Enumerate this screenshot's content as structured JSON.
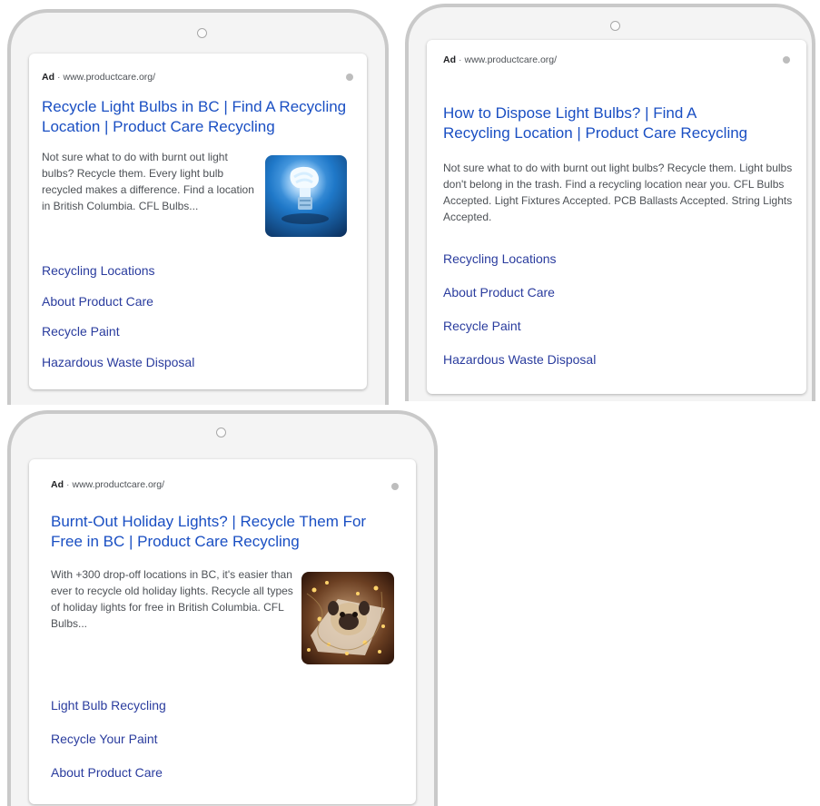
{
  "ads": [
    {
      "label": "Ad",
      "url": "www.productcare.org/",
      "headline_line1": "Recycle Light Bulbs in BC | Find A Recycling",
      "headline_line2": "Location | Product Care Recycling",
      "description": "Not sure what to do with burnt out light bulbs? Recycle them. Every light bulb recycled makes a difference. Find a location in British Columbia. CFL Bulbs...",
      "image_icon": "light-bulb-image",
      "sitelinks": [
        "Recycling Locations",
        "About Product Care",
        "Recycle Paint",
        "Hazardous Waste Disposal"
      ]
    },
    {
      "label": "Ad",
      "url": "www.productcare.org/",
      "headline_line1": "How to Dispose Light Bulbs? | Find A",
      "headline_line2": "Recycling Location | Product Care Recycling",
      "description": "Not sure what to do with burnt out light bulbs? Recycle them. Light bulbs don't belong in the trash. Find a recycling location near you. CFL Bulbs Accepted. Light Fixtures Accepted. PCB Ballasts Accepted. String Lights Accepted.",
      "sitelinks": [
        "Recycling Locations",
        "About Product Care",
        "Recycle Paint",
        "Hazardous Waste Disposal"
      ]
    },
    {
      "label": "Ad",
      "url": "www.productcare.org/",
      "headline_line1": "Burnt-Out Holiday Lights? | Recycle Them For",
      "headline_line2": "Free in BC | Product Care Recycling",
      "description": "With +300 drop-off locations in BC, it's easier than ever to recycle old holiday lights. Recycle all types of holiday lights for free in British Columbia. CFL Bulbs...",
      "image_icon": "pug-holiday-lights-image",
      "sitelinks": [
        "Light Bulb Recycling",
        "Recycle Your Paint",
        "About Product Care"
      ]
    }
  ],
  "colors": {
    "headline": "#1a4fc3",
    "sitelink": "#2a3c9e",
    "body_text": "#4d5156"
  }
}
